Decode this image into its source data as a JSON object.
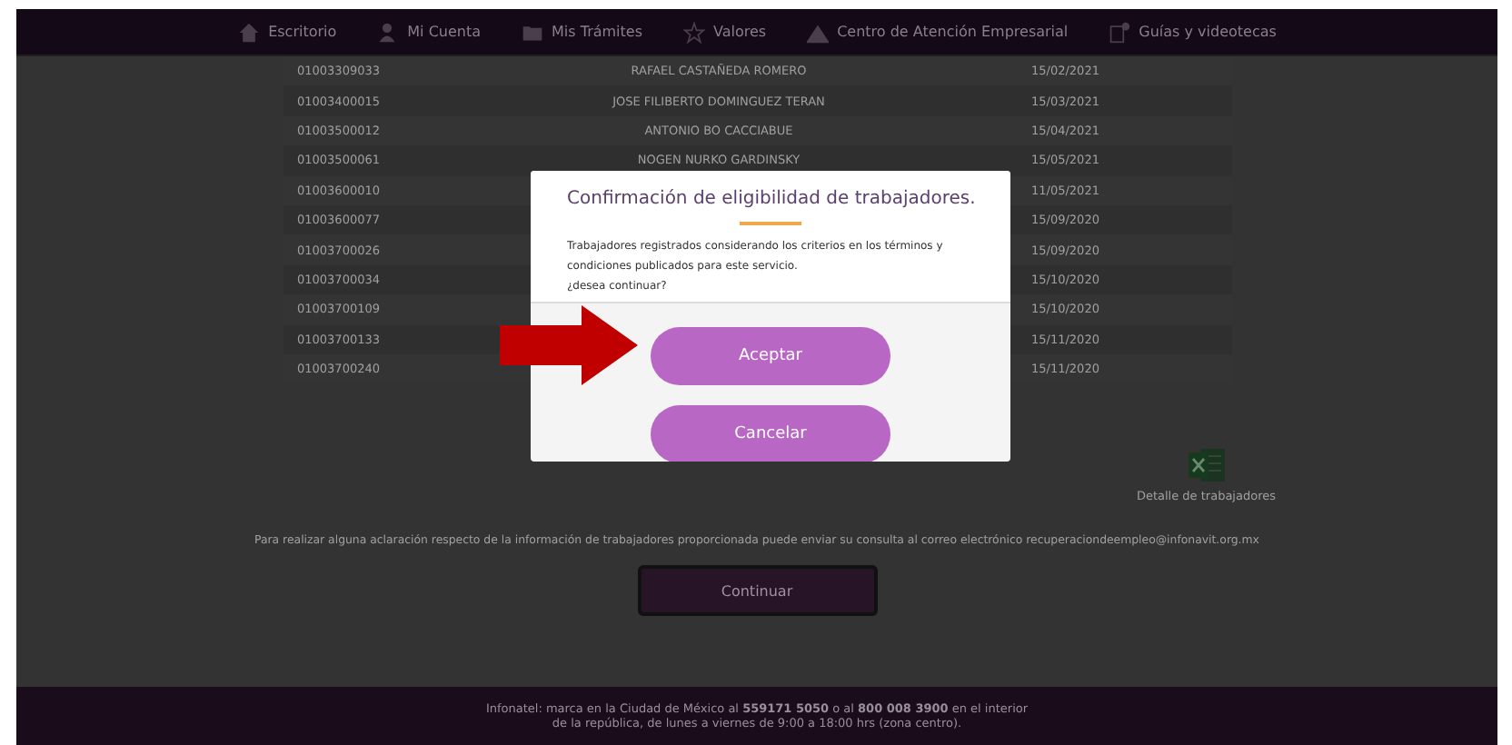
{
  "nav": {
    "items": [
      {
        "label": "Escritorio"
      },
      {
        "label": "Mi Cuenta"
      },
      {
        "label": "Mis Trámites"
      },
      {
        "label": "Valores"
      },
      {
        "label": "Centro de Atención Empresarial"
      },
      {
        "label": "Guías y videotecas"
      }
    ]
  },
  "table": {
    "rows": [
      {
        "id": "01003309033",
        "name": "RAFAEL CASTAÑEDA ROMERO",
        "date": "15/02/2021"
      },
      {
        "id": "01003400015",
        "name": "JOSE FILIBERTO DOMINGUEZ TERAN",
        "date": "15/03/2021"
      },
      {
        "id": "01003500012",
        "name": "ANTONIO BO CACCIABUE",
        "date": "15/04/2021"
      },
      {
        "id": "01003500061",
        "name": "NOGEN NURKO GARDINSKY",
        "date": "15/05/2021"
      },
      {
        "id": "01003600010",
        "date": "11/05/2021"
      },
      {
        "id": "01003600077",
        "date": "15/09/2020"
      },
      {
        "id": "01003700026",
        "date": "15/09/2020"
      },
      {
        "id": "01003700034",
        "date": "15/10/2020"
      },
      {
        "id": "01003700109",
        "date": "15/10/2020"
      },
      {
        "id": "01003700133",
        "date": "15/11/2020"
      },
      {
        "id": "01003700240",
        "date": "15/11/2020"
      }
    ]
  },
  "download": {
    "label": "Detalle de trabajadores"
  },
  "info_text": "Para realizar alguna aclaración respecto de la información de trabajadores proporcionada puede enviar su consulta al correo electrónico recuperaciondeempleo@infonavit.org.mx",
  "continue_button": {
    "label": "Continuar"
  },
  "footer": {
    "text": "Infonatel: marca en la Ciudad de México al **559171 5050** o al **800 008 3900** en el interior de la república, de lunes a viernes de 9:00 a 18:00 hrs (zona centro)."
  },
  "modal": {
    "title": "Confirmación de eligibilidad de trabajadores.",
    "message": [
      "Trabajadores registrados considerando los criterios en los términos y condiciones publicados para este servicio.",
      "¿desea continuar?"
    ],
    "buttons": [
      {
        "label": "Aceptar"
      },
      {
        "label": "Cancelar"
      }
    ]
  }
}
